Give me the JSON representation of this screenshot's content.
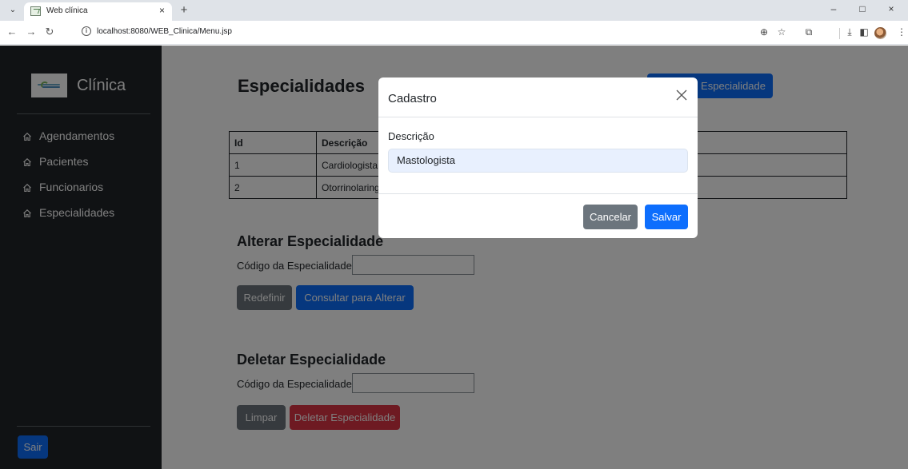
{
  "browser": {
    "tab_title": "Web clínica",
    "tab_close": "×",
    "new_tab": "+",
    "url": "localhost:8080/WEB_Clinica/Menu.jsp",
    "window_minimize": "–",
    "window_maximize": "□",
    "window_close": "×"
  },
  "sidebar": {
    "brand": "Clínica",
    "items": [
      {
        "label": "Agendamentos"
      },
      {
        "label": "Pacientes"
      },
      {
        "label": "Funcionarios"
      },
      {
        "label": "Especialidades"
      }
    ],
    "logout_label": "Sair"
  },
  "main": {
    "title": "Especialidades",
    "new_button_label": "Especialidade",
    "table": {
      "headers": [
        "Id",
        "Descrição"
      ],
      "rows": [
        [
          "1",
          "Cardiologista"
        ],
        [
          "2",
          "Otorrinolaring"
        ]
      ]
    },
    "alter": {
      "title": "Alterar Especialidade",
      "field_label": "Código da Especialidade:",
      "reset_label": "Redefinir",
      "submit_label": "Consultar para Alterar"
    },
    "delete": {
      "title": "Deletar Especialidade",
      "field_label": "Código da Especialidade:",
      "clear_label": "Limpar",
      "submit_label": "Deletar Especialidade"
    }
  },
  "modal": {
    "title": "Cadastro",
    "field_label": "Descrição",
    "field_value": "Mastologista",
    "cancel_label": "Cancelar",
    "save_label": "Salvar"
  },
  "colors": {
    "primary": "#0d6efd",
    "secondary": "#6c757d",
    "danger": "#dc3545",
    "sidebar": "#212529"
  }
}
